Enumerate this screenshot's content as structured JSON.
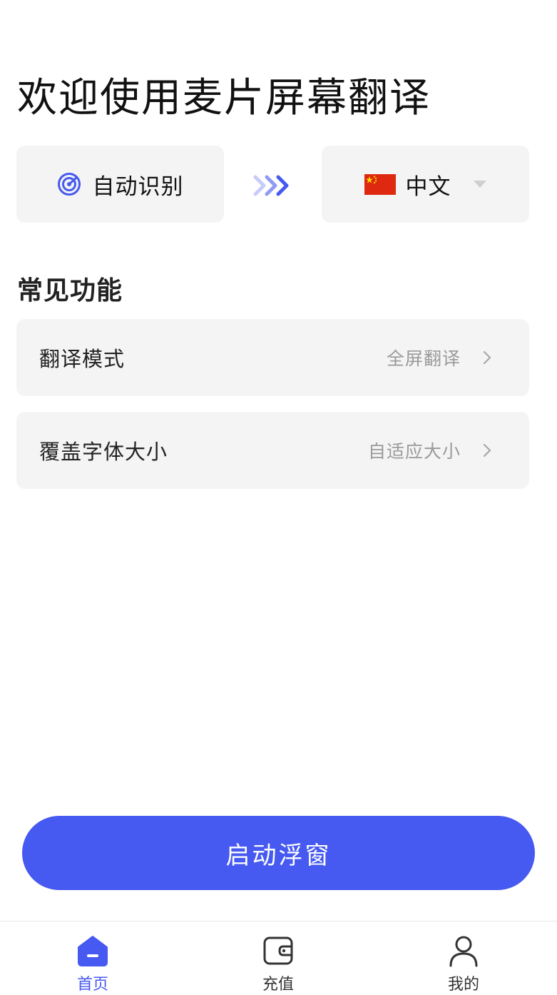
{
  "header": {
    "title": "欢迎使用麦片屏幕翻译"
  },
  "language": {
    "source": {
      "label": "自动识别",
      "icon": "target-icon"
    },
    "swap_icon": "triple-chevron-right-icon",
    "target": {
      "label": "中文",
      "flag": "china-flag-icon",
      "dropdown_icon": "caret-down-icon"
    }
  },
  "features": {
    "title": "常见功能",
    "items": [
      {
        "label": "翻译模式",
        "value": "全屏翻译"
      },
      {
        "label": "覆盖字体大小",
        "value": "自适应大小"
      }
    ]
  },
  "cta": {
    "label": "启动浮窗"
  },
  "tabbar": {
    "items": [
      {
        "label": "首页",
        "icon": "home-icon",
        "active": true
      },
      {
        "label": "充值",
        "icon": "wallet-icon",
        "active": false
      },
      {
        "label": "我的",
        "icon": "user-icon",
        "active": false
      }
    ]
  },
  "colors": {
    "accent": "#4659f0",
    "card": "#f4f4f4",
    "muted_text": "#9a9a9a"
  }
}
